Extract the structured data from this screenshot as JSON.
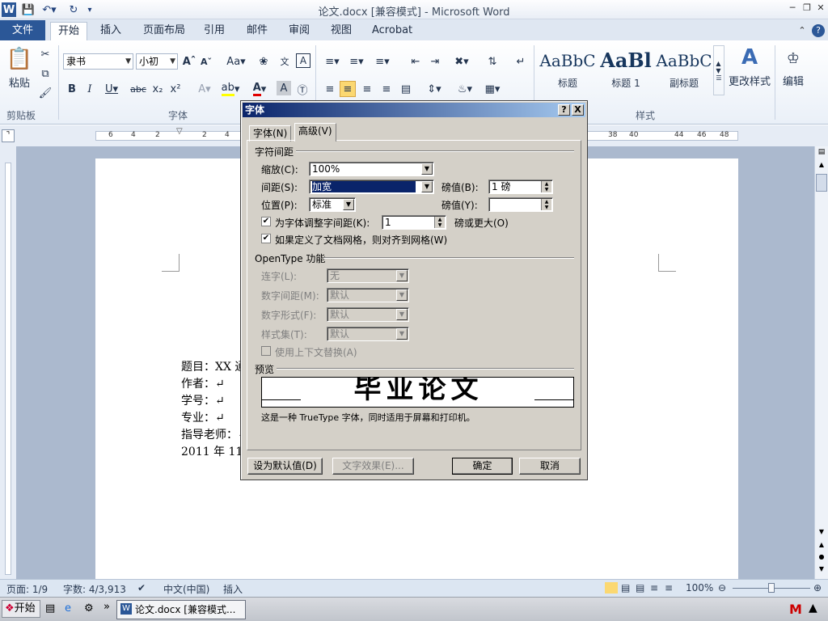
{
  "window": {
    "title": "论文.docx [兼容模式] - Microsoft Word",
    "app_icon": "W"
  },
  "ribbon_tabs": [
    "文件",
    "开始",
    "插入",
    "页面布局",
    "引用",
    "邮件",
    "审阅",
    "视图",
    "Acrobat"
  ],
  "ribbon": {
    "clipboard": {
      "paste_label": "粘贴",
      "group_label": "剪贴板"
    },
    "font": {
      "font_name": "隶书",
      "font_size": "小初",
      "group_label": "字体"
    },
    "styles": {
      "items": [
        {
          "sample": "AaBbC",
          "label": "标题"
        },
        {
          "sample": "AaBl",
          "label": "标题 1"
        },
        {
          "sample": "AaBbC",
          "label": "副标题"
        }
      ],
      "change_styles_label": "更改样式",
      "group_label": "样式"
    },
    "editing": {
      "label": "编辑"
    }
  },
  "ruler": {
    "ticks": [
      "6",
      "4",
      "2",
      "",
      "2",
      "4",
      "38",
      "40",
      "44",
      "46",
      "48"
    ]
  },
  "document": {
    "lines": [
      "题目：XX 通",
      "作者：↵",
      "学号：↵",
      "专业：↵",
      "指导老师：↵",
      "2011 年 11 月"
    ]
  },
  "dialog": {
    "title": "字体",
    "help_btn": "?",
    "close_btn": "X",
    "tabs": [
      "字体(N)",
      "高级(V)"
    ],
    "char_spacing": {
      "section": "字符间距",
      "scale_label": "缩放(C):",
      "scale_value": "100%",
      "spacing_label": "间距(S):",
      "spacing_value": "加宽",
      "spacing_by_label": "磅值(B):",
      "spacing_by_value": "1 磅",
      "position_label": "位置(P):",
      "position_value": "标准",
      "position_by_label": "磅值(Y):",
      "position_by_value": "",
      "kerning_label": "为字体调整字间距(K):",
      "kerning_value": "1",
      "kerning_suffix": "磅或更大(O)",
      "kerning_checked": true,
      "grid_label": "如果定义了文档网格，则对齐到网格(W)",
      "grid_checked": true
    },
    "opentype": {
      "section": "OpenType 功能",
      "ligatures_label": "连字(L):",
      "ligatures_value": "无",
      "num_spacing_label": "数字间距(M):",
      "num_spacing_value": "默认",
      "num_forms_label": "数字形式(F):",
      "num_forms_value": "默认",
      "stylistic_label": "样式集(T):",
      "stylistic_value": "默认",
      "contextual_label": "使用上下文替换(A)"
    },
    "preview": {
      "section": "预览",
      "sample_text": "毕业论文",
      "note": "这是一种 TrueType 字体，同时适用于屏幕和打印机。"
    },
    "buttons": {
      "set_default": "设为默认值(D)",
      "text_effects": "文字效果(E)...",
      "ok": "确定",
      "cancel": "取消"
    }
  },
  "statusbar": {
    "page": "页面: 1/9",
    "words": "字数: 4/3,913",
    "language": "中文(中国)",
    "insert_mode": "插入",
    "zoom": "100%"
  },
  "taskbar": {
    "start_label": "开始",
    "task_label": "论文.docx [兼容模式..."
  }
}
